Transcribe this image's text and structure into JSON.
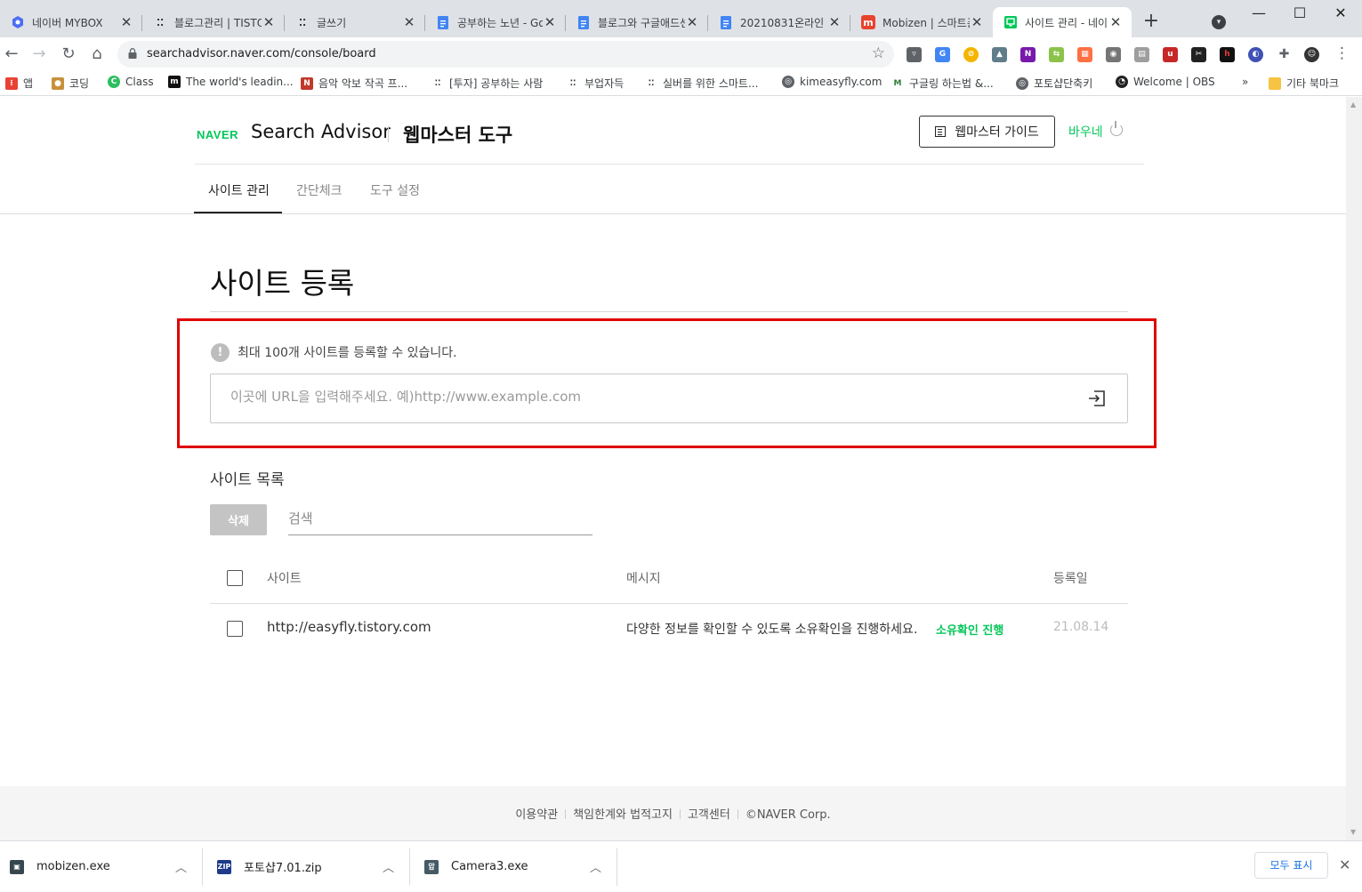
{
  "browser": {
    "tabs": [
      {
        "title": "네이버 MYBOX",
        "icon": "mybox-icon",
        "color": "#4e6ef2"
      },
      {
        "title": "블로그관리 | TISTORY",
        "icon": "tistory-icon",
        "color": "#333333"
      },
      {
        "title": "글쓰기",
        "icon": "tistory-icon",
        "color": "#333333"
      },
      {
        "title": "공부하는 노년 - Google Docs",
        "icon": "docs-icon",
        "color": "#4285f4"
      },
      {
        "title": "블로그와 구글애드센스",
        "icon": "docs-icon",
        "color": "#4285f4"
      },
      {
        "title": "20210831온라인",
        "icon": "docs-icon",
        "color": "#4285f4"
      },
      {
        "title": "Mobizen | 스마트폰",
        "icon": "mobizen-icon",
        "color": "#e8432e"
      },
      {
        "title": "사이트 관리 - 네이버",
        "icon": "naver-sa-icon",
        "color": "#03c75a"
      }
    ],
    "address": "searchadvisor.naver.com/console/board",
    "bookmarks": [
      {
        "label": "앱",
        "icon": "apps-icon",
        "color": "#e94235"
      },
      {
        "label": "코딩",
        "icon": "dog-icon",
        "color": "#c7903a"
      },
      {
        "label": "Class",
        "icon": "class-icon",
        "color": "#2dbe60"
      },
      {
        "label": "The world's leadin...",
        "icon": "m-icon",
        "color": "#111111"
      },
      {
        "label": "음악 악보 작곡 프...",
        "icon": "noteflight-icon",
        "color": "#c0392b"
      },
      {
        "label": "[투자] 공부하는 사람",
        "icon": "tistory-icon",
        "color": "#333333"
      },
      {
        "label": "부업자득",
        "icon": "tistory-icon",
        "color": "#333333"
      },
      {
        "label": "실버를 위한 스마트...",
        "icon": "tistory-icon",
        "color": "#333333"
      },
      {
        "label": "kimeasyfly.com",
        "icon": "globe-icon",
        "color": "#5f6368"
      },
      {
        "label": "구글링 하는법 &...",
        "icon": "m-green-icon",
        "color": "#2e7d32"
      },
      {
        "label": "포토샵단축키",
        "icon": "globe-icon",
        "color": "#5f6368"
      },
      {
        "label": "Welcome | OBS",
        "icon": "obs-icon",
        "color": "#222222"
      }
    ],
    "bookmarks_overflow": "»",
    "other_bookmarks": "기타 북마크"
  },
  "header": {
    "brand": "NAVER",
    "product": "Search Advisor",
    "tool": "웹마스터 도구",
    "guide_button": "웹마스터 가이드",
    "user": "바우네"
  },
  "nav": {
    "tabs": [
      "사이트 관리",
      "간단체크",
      "도구 설정"
    ]
  },
  "main": {
    "title": "사이트 등록",
    "notice": "최대 100개 사이트를 등록할 수 있습니다.",
    "url_placeholder": "이곳에 URL을 입력해주세요. 예)http://www.example.com",
    "list_title": "사이트 목록",
    "delete_button": "삭제",
    "search_placeholder": "검색",
    "columns": [
      "사이트",
      "메시지",
      "등록일"
    ],
    "rows": [
      {
        "site": "http://easyfly.tistory.com",
        "message": "다양한 정보를 확인할 수 있도록 소유확인을 진행하세요.",
        "action": "소유확인 진행",
        "date": "21.08.14"
      }
    ]
  },
  "footer": {
    "links": [
      "이용약관",
      "책임한계와 법적고지",
      "고객센터",
      "©NAVER Corp."
    ]
  },
  "downloads": {
    "items": [
      {
        "file": "mobizen.exe",
        "icon": "exe-icon"
      },
      {
        "file": "포토샵7.01.zip",
        "icon": "zip-icon"
      },
      {
        "file": "Camera3.exe",
        "icon": "exe-icon"
      }
    ],
    "show_all": "모두 표시"
  },
  "colors": {
    "naver_green": "#03c75a",
    "highlight_red": "#e00000"
  }
}
